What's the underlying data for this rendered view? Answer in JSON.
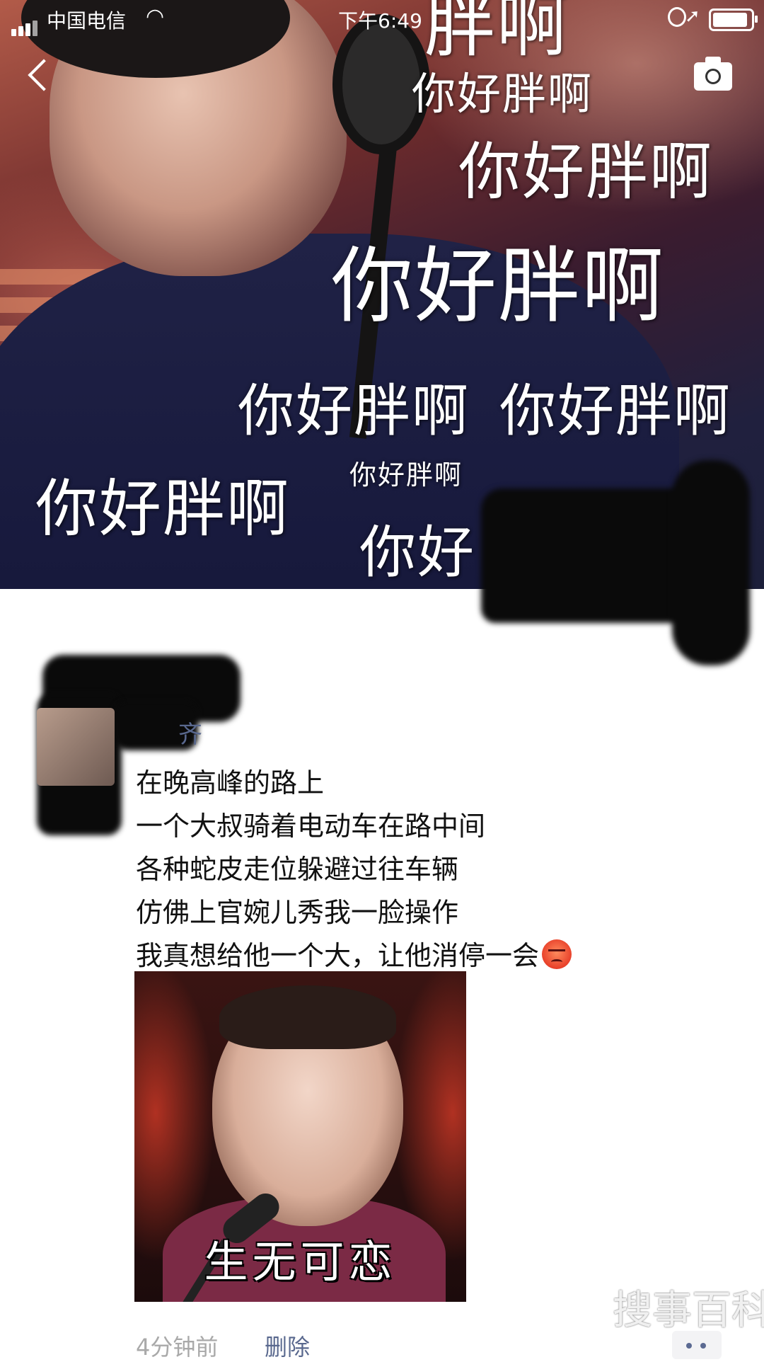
{
  "status_bar": {
    "carrier": "中国电信",
    "time": "下午6:49"
  },
  "cover": {
    "meme_top": "胖啊",
    "meme_lines": [
      "你好胖啊",
      "你好胖啊",
      "你好胖啊",
      "你好胖啊",
      "你好胖啊",
      "你好胖啊",
      "你好胖啊",
      "你好"
    ]
  },
  "post": {
    "username_visible": "齐",
    "lines": [
      "在晚高峰的路上",
      "一个大叔骑着电动车在路中间",
      "各种蛇皮走位躲避过往车辆",
      "仿佛上官婉儿秀我一脸操作",
      "我真想给他一个大，让他消停一会"
    ],
    "emoji": "angry-face-emoji",
    "image_caption": "生无可恋",
    "timestamp": "4分钟前",
    "delete_label": "删除"
  },
  "watermark": "搜事百科"
}
